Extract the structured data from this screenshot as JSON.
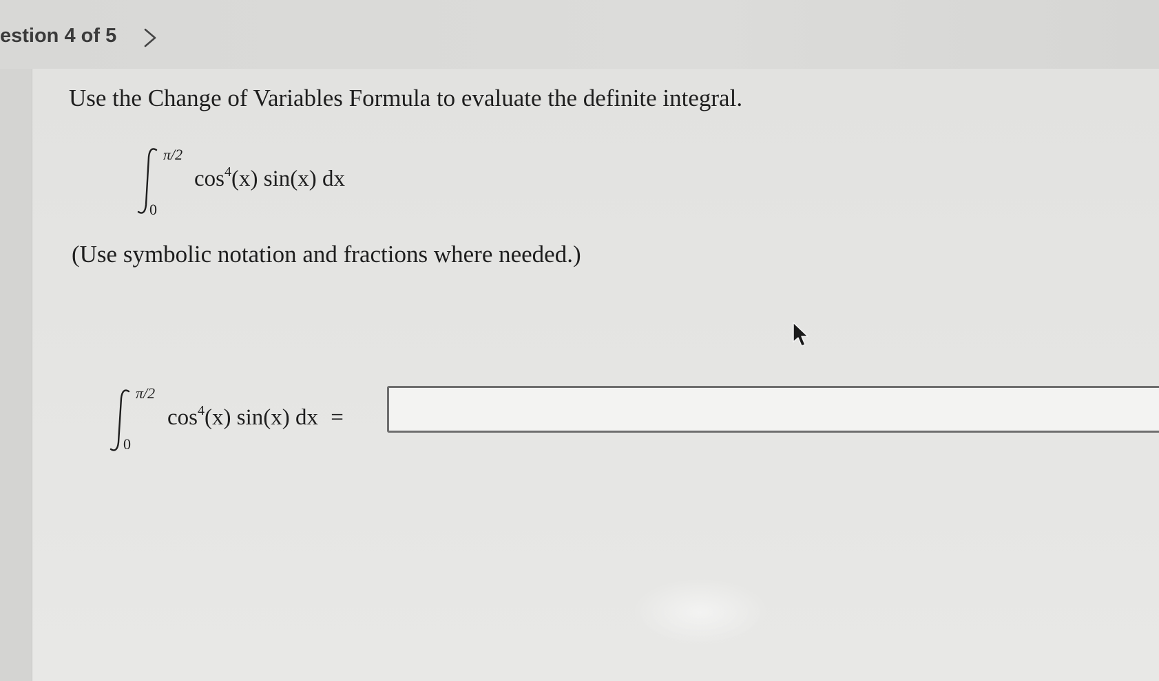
{
  "header": {
    "question_label": "estion 4 of 5",
    "next_icon": "chevron-right-icon"
  },
  "question": {
    "prompt": "Use the Change of Variables Formula to evaluate the definite integral.",
    "integral": {
      "upper_limit": "π/2",
      "lower_limit": "0",
      "integrand_func": "cos",
      "exponent": "4",
      "integrand_rest": "(x) sin(x) dx"
    },
    "hint": "(Use symbolic notation and fractions where needed.)",
    "answer_equals": "=",
    "answer_value": "",
    "answer_placeholder": ""
  },
  "icons": {
    "cursor": "mouse-pointer-icon"
  },
  "colors": {
    "background": "#d9d9d7",
    "panel": "#e4e4e2",
    "text": "#1e1e1e",
    "input_border": "#6e6e6e"
  }
}
